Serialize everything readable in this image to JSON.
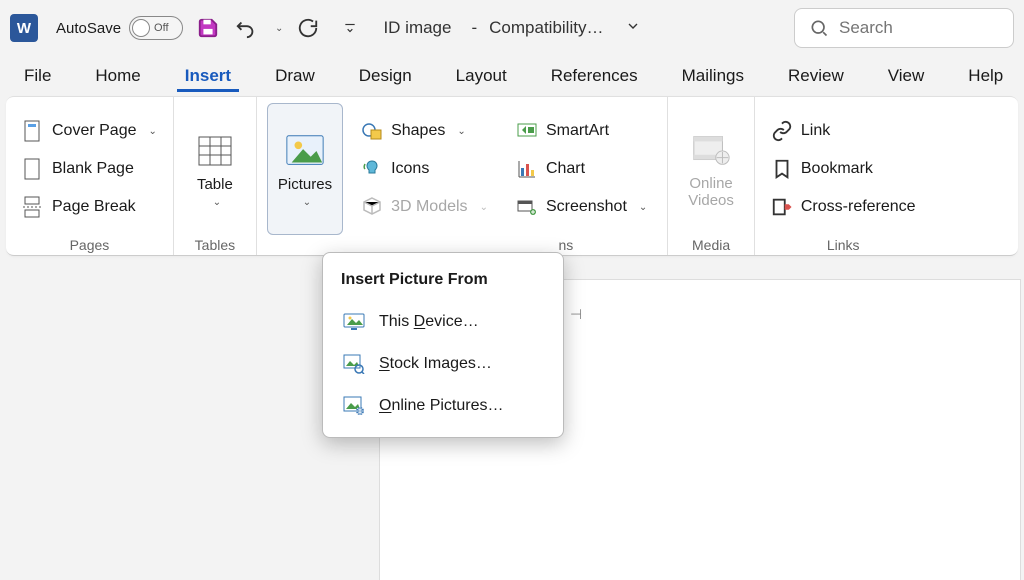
{
  "titlebar": {
    "autosave_label": "AutoSave",
    "autosave_state": "Off",
    "doc_name": "ID image",
    "separator": "-",
    "compat": "Compatibility…"
  },
  "search": {
    "placeholder": "Search"
  },
  "tabs": [
    "File",
    "Home",
    "Insert",
    "Draw",
    "Design",
    "Layout",
    "References",
    "Mailings",
    "Review",
    "View",
    "Help"
  ],
  "active_tab_index": 2,
  "ribbon": {
    "pages": {
      "cover_page": "Cover Page",
      "blank_page": "Blank Page",
      "page_break": "Page Break",
      "group": "Pages"
    },
    "tables": {
      "table": "Table",
      "group": "Tables"
    },
    "illustrations": {
      "pictures": "Pictures",
      "shapes": "Shapes",
      "icons": "Icons",
      "models": "3D Models",
      "smartart": "SmartArt",
      "chart": "Chart",
      "screenshot": "Screenshot",
      "group": "Illustrations"
    },
    "media": {
      "online_videos_l1": "Online",
      "online_videos_l2": "Videos",
      "group": "Media"
    },
    "links": {
      "link": "Link",
      "bookmark": "Bookmark",
      "crossref": "Cross-reference",
      "group": "Links"
    }
  },
  "dropdown": {
    "header": "Insert Picture From",
    "this_device_pre": "This ",
    "this_device_u": "D",
    "this_device_post": "evice…",
    "stock_u": "S",
    "stock_post": "tock Images…",
    "online_u": "O",
    "online_post": "nline Pictures…"
  }
}
